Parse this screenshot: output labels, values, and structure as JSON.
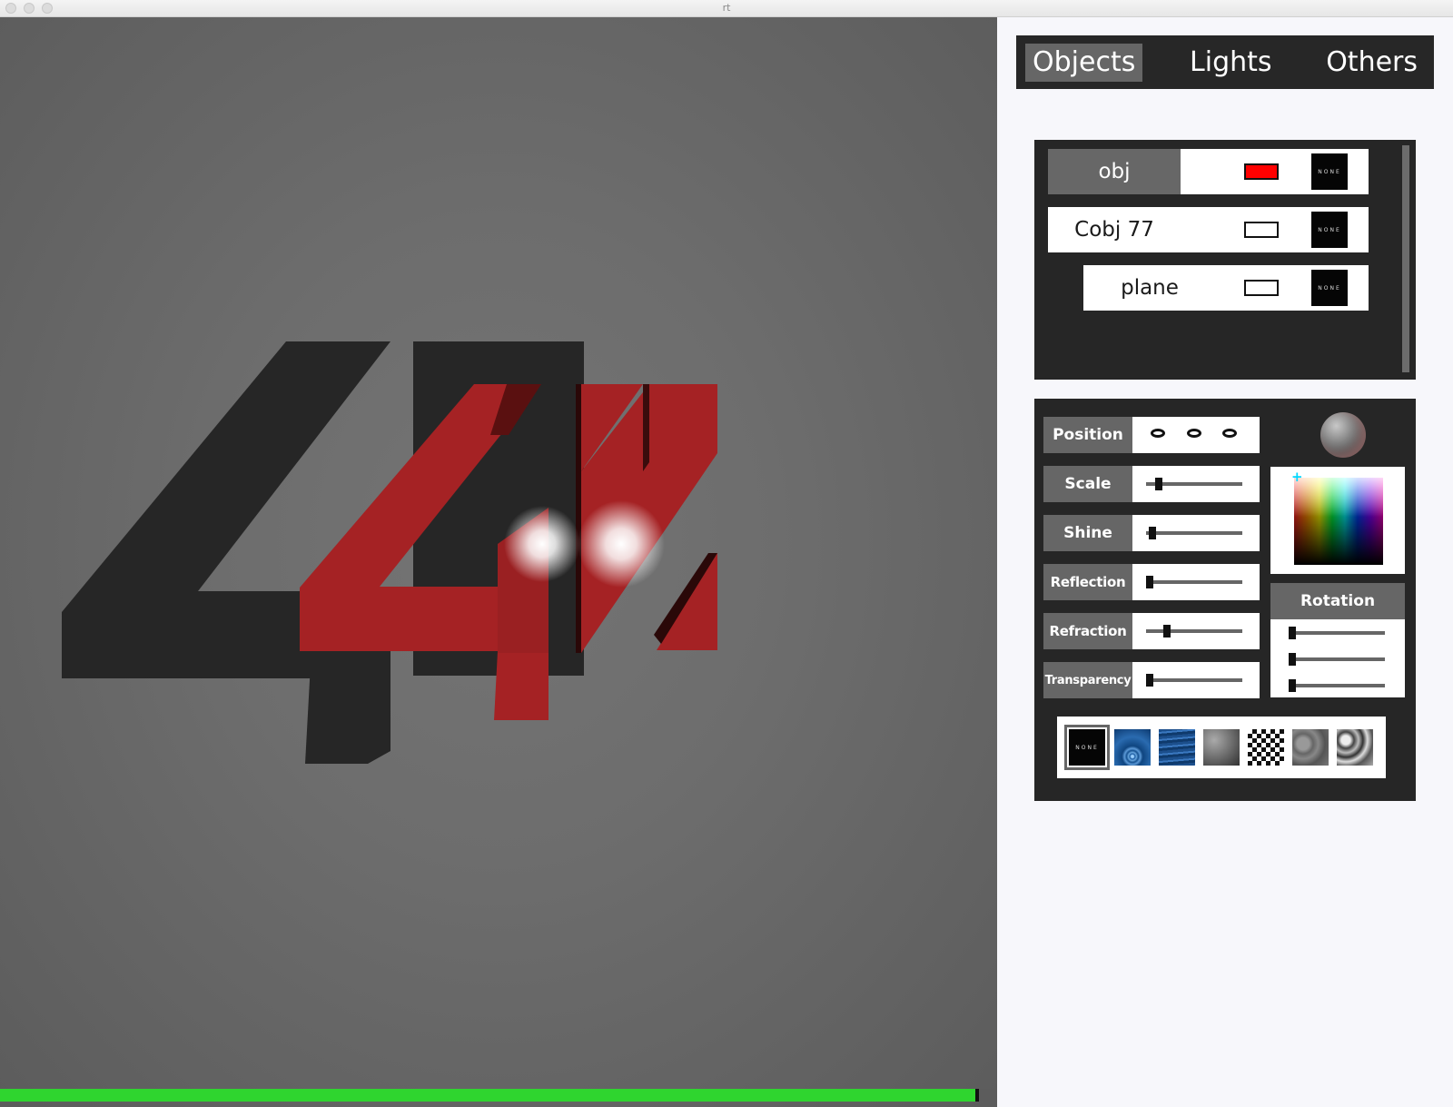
{
  "window": {
    "title": "rt"
  },
  "tabs": [
    {
      "label": "Objects",
      "active": true
    },
    {
      "label": "Lights",
      "active": false
    },
    {
      "label": "Others",
      "active": false
    }
  ],
  "objects": [
    {
      "name": "obj",
      "selected": true,
      "color": "#ff0000",
      "texture": "NONE"
    },
    {
      "name": "Cobj 77",
      "selected": false,
      "color": "#ffffff",
      "texture": "NONE"
    },
    {
      "name": "plane",
      "selected": false,
      "color": "#ffffff",
      "texture": "NONE"
    }
  ],
  "properties": {
    "position": {
      "label": "Position"
    },
    "scale": {
      "label": "Scale"
    },
    "shine": {
      "label": "Shine"
    },
    "reflection": {
      "label": "Reflection"
    },
    "refraction": {
      "label": "Refraction"
    },
    "transparency": {
      "label": "Transparency"
    }
  },
  "rotation": {
    "label": "Rotation"
  },
  "textures": [
    "none",
    "water-ripple",
    "water-waves",
    "noise-gray",
    "checkerboard",
    "marble",
    "perlin-noise"
  ],
  "texture_none_label": "NONE",
  "render_progress": 1.0,
  "colors": {
    "accent_green": "#2fd52f",
    "object_red": "#a52224",
    "panel_dark": "#262626",
    "label_gray": "#666666"
  }
}
